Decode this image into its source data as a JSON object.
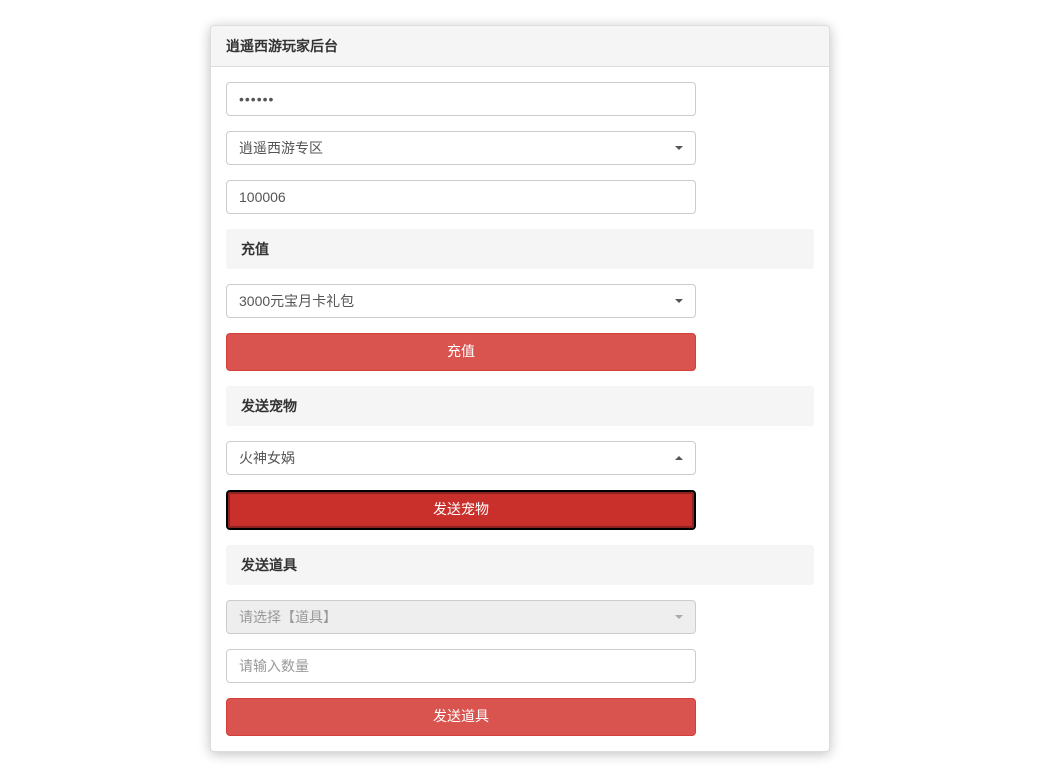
{
  "header": {
    "title": "逍遥西游玩家后台"
  },
  "form": {
    "password_value": "••••••",
    "zone_select": "逍遥西游专区",
    "id_value": "100006"
  },
  "recharge": {
    "section_title": "充值",
    "package_select": "3000元宝月卡礼包",
    "button_label": "充值"
  },
  "send_pet": {
    "section_title": "发送宠物",
    "pet_select": "火神女娲",
    "button_label": "发送宠物"
  },
  "send_item": {
    "section_title": "发送道具",
    "item_select_placeholder": "请选择【道具】",
    "quantity_placeholder": "请输入数量",
    "button_label": "发送道具"
  }
}
